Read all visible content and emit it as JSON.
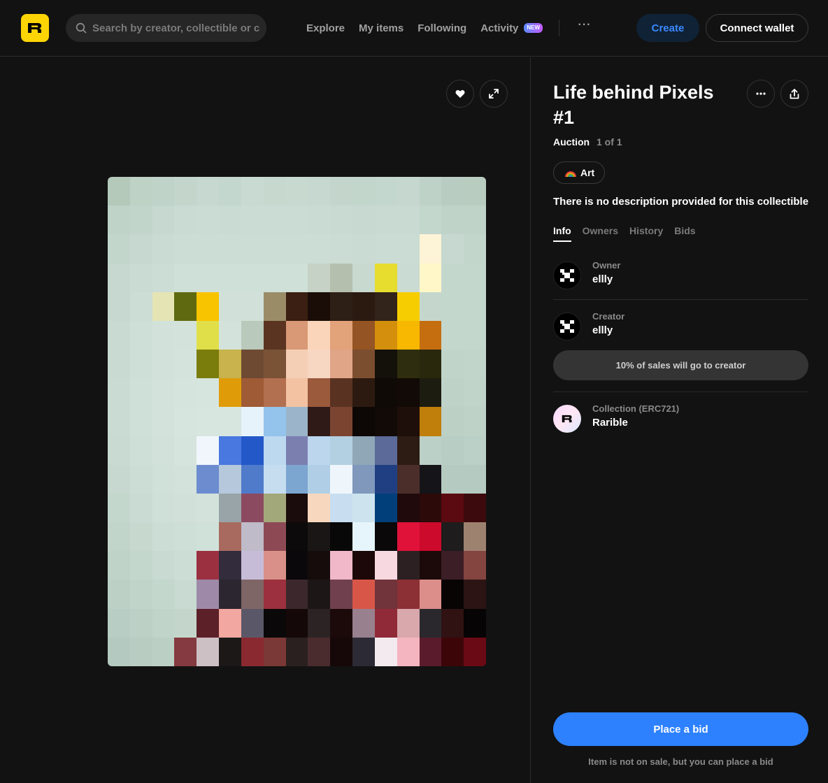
{
  "header": {
    "search_placeholder": "Search by creator, collectible or collection",
    "nav": [
      "Explore",
      "My items",
      "Following",
      "Activity"
    ],
    "activity_badge": "NEW",
    "more_label": "···",
    "create_label": "Create",
    "connect_label": "Connect wallet"
  },
  "item": {
    "title": "Life behind Pixels #1",
    "sale_type": "Auction",
    "edition": "1 of 1",
    "tag": "Art",
    "description": "There is no description provided for this collectible",
    "tabs": [
      "Info",
      "Owners",
      "History",
      "Bids"
    ],
    "active_tab": "Info",
    "owner": {
      "role": "Owner",
      "name": "ellly"
    },
    "creator": {
      "role": "Creator",
      "name": "ellly"
    },
    "royalty_text": "10% of sales will go to creator",
    "collection": {
      "role": "Collection (ERC721)",
      "name": "Rarible"
    }
  },
  "actions": {
    "bid_label": "Place a bid",
    "bid_note": "Item is not on sale, but you can place a bid"
  },
  "colors": {
    "accent": "#2d81ff",
    "logo_yellow": "#fed504",
    "background": "#121212"
  },
  "icons": {
    "search": "search-icon",
    "like": "heart-icon",
    "fullscreen": "expand-icon",
    "options": "more-icon",
    "share": "share-icon"
  },
  "artwork_pixels": [
    [
      "#b4c9b9",
      "#bfd2c6",
      "#bfd3c8",
      "#c4d6cc",
      "#c6d8cf",
      "#c4d7ce",
      "#c8dad1",
      "#c7d9cf",
      "#c8d9d0",
      "#c6d8cf",
      "#c4d6cc",
      "#c3d6cc",
      "#c4d7ce",
      "#c5d7ce",
      "#bed2c7",
      "#b8ccc1",
      "#b8ccbf"
    ],
    [
      "#bfd3c8",
      "#c2d5cb",
      "#c6d8cf",
      "#c9dbd2",
      "#cadcd3",
      "#c9dbd2",
      "#cadcd3",
      "#cadcd3",
      "#cadcd3",
      "#c9dbd2",
      "#c8dad1",
      "#c7d9d0",
      "#c8dad1",
      "#c8dad1",
      "#c4d7cd",
      "#c0d3c9",
      "#bfd3c8"
    ],
    [
      "#c3d6cc",
      "#c6d8cf",
      "#c9dbd2",
      "#cbddd4",
      "#ccddd5",
      "#cbddd4",
      "#ccddd5",
      "#ccddd5",
      "#ccddd5",
      "#cbddd4",
      "#cadcd3",
      "#c9dbd2",
      "#cadcd3",
      "#cadcd3",
      "#fdf3d6",
      "#c6d8cf",
      "#c3d6cc"
    ],
    [
      "#c6d8cf",
      "#c9dbd2",
      "#ccddd5",
      "#cfe0d8",
      "#cfe0d8",
      "#cee0d7",
      "#cfe0d8",
      "#cfe0d8",
      "#cfe0d8",
      "#c5d2c5",
      "#b5bfae",
      "#c8d9d0",
      "#e6dd2e",
      "#c9dbd2",
      "#fff7c8",
      "#c4d7cd",
      "#c4d7cd"
    ],
    [
      "#c6d8cf",
      "#ccddd5",
      "#e4e4b4",
      "#5f6a10",
      "#f8c400",
      "#d1e1d9",
      "#d1e1d9",
      "#9b8c68",
      "#3a1f12",
      "#1a0d08",
      "#2e1f16",
      "#2b1a10",
      "#32241a",
      "#f6cd00",
      "#c5d7cd",
      "#c4d7cd",
      "#c4d7cd"
    ],
    [
      "#c8dad1",
      "#cddfd6",
      "#d2e2da",
      "#d3e3db",
      "#e0df4a",
      "#d3e3db",
      "#b9c9bb",
      "#5a3420",
      "#d99876",
      "#fbd5b9",
      "#e2a27a",
      "#955423",
      "#d4900c",
      "#f8b700",
      "#c56e10",
      "#c4d7cd",
      "#c4d7cd"
    ],
    [
      "#c8dad1",
      "#cddfd6",
      "#d2e2da",
      "#d4e4dc",
      "#7a7d0c",
      "#c8b34c",
      "#6f4a33",
      "#7a5236",
      "#f4cfb5",
      "#f7d7c2",
      "#e0a587",
      "#7b4e2f",
      "#13110a",
      "#2e2d0f",
      "#2a280c",
      "#c0d4ca",
      "#c2d5cb"
    ],
    [
      "#c9dbd2",
      "#cee0d7",
      "#d3e3db",
      "#d5e5dd",
      "#d6e5de",
      "#e09c08",
      "#9e5b35",
      "#b27050",
      "#f3c2a3",
      "#9b5a3c",
      "#5a3222",
      "#2c1a10",
      "#100a06",
      "#120a06",
      "#1c1c10",
      "#bed2c8",
      "#c0d4ca"
    ],
    [
      "#c9dbd2",
      "#cee0d7",
      "#d3e3db",
      "#d6e5de",
      "#d7e6df",
      "#d7e6df",
      "#e7f3fa",
      "#94c3ec",
      "#9bb4ca",
      "#2f1a18",
      "#7b4431",
      "#0d0705",
      "#120a06",
      "#1e0f0a",
      "#c07e0a",
      "#bcd0c6",
      "#bed2c8"
    ],
    [
      "#c8dad1",
      "#cddfd6",
      "#d2e2da",
      "#d5e5dd",
      "#f0f6fc",
      "#4878e0",
      "#2358c8",
      "#bcd9f0",
      "#7b7fb0",
      "#bcd6ee",
      "#b3cfe2",
      "#8fa7b7",
      "#5b6a98",
      "#2d1c14",
      "#bbd0c6",
      "#b8cdc3",
      "#bbd0c6"
    ],
    [
      "#c6d8cf",
      "#cbddd4",
      "#d0e1d9",
      "#d3e3db",
      "#6c8ccf",
      "#b5c8dc",
      "#4f7bca",
      "#c6dcef",
      "#7ca5d0",
      "#b0cfe6",
      "#eef6fc",
      "#7f98bc",
      "#203f82",
      "#4b2e2a",
      "#151418",
      "#b5cac0",
      "#b5cac0"
    ],
    [
      "#c4d7cd",
      "#c9dbd2",
      "#cee0d7",
      "#d1e1d9",
      "#d3e3db",
      "#98a4a7",
      "#8c4a60",
      "#a3a87a",
      "#1a0c0c",
      "#f7d7bd",
      "#c8def0",
      "#cde4ef",
      "#003f7a",
      "#200a0c",
      "#2c0a0a",
      "#5a0a10",
      "#3c0a0c"
    ],
    [
      "#c2d5cb",
      "#c7d9cf",
      "#cbddd4",
      "#cedfd7",
      "#d0e1d9",
      "#a86a5e",
      "#bfbbc8",
      "#8e4a54",
      "#0c0a0a",
      "#1a1616",
      "#080808",
      "#e6f4fc",
      "#0a0808",
      "#e0123a",
      "#cc0a2c",
      "#1e1c1c",
      "#9e8270"
    ],
    [
      "#bfd3c8",
      "#c4d7cd",
      "#c8dad1",
      "#cbddd4",
      "#9a3040",
      "#332c3c",
      "#c6bcd8",
      "#d89088",
      "#0a080a",
      "#160c0c",
      "#f0b8c8",
      "#1c0808",
      "#f8d8e0",
      "#2c2022",
      "#1c0a0a",
      "#3c1e26",
      "#844440"
    ],
    [
      "#bcd0c6",
      "#c0d4ca",
      "#c4d7cd",
      "#c8dad1",
      "#9e8aa8",
      "#2c2630",
      "#7e6666",
      "#9c303e",
      "#3c282c",
      "#1c1616",
      "#70404e",
      "#d85648",
      "#70343a",
      "#8c3036",
      "#dc8e8a",
      "#080404",
      "#2c1414"
    ],
    [
      "#b8cdc3",
      "#bcd0c6",
      "#c0d4ca",
      "#c4d6cc",
      "#5c2028",
      "#f2a8a0",
      "#5a5868",
      "#0a0808",
      "#140808",
      "#2c2424",
      "#1c0a0a",
      "#98808e",
      "#902a38",
      "#d8a8ac",
      "#2a282c",
      "#301212",
      "#060404"
    ],
    [
      "#b4c9bf",
      "#b8ccc1",
      "#bccfc5",
      "#843a40",
      "#ccc0c4",
      "#1c1818",
      "#8a2a30",
      "#7a3836",
      "#2a2020",
      "#4a2c2e",
      "#160808",
      "#2c2a34",
      "#f2eaee",
      "#f4b4c0",
      "#5a1c2c",
      "#3c0608",
      "#6a0a14"
    ],
    [
      "#b0c5bc",
      "#b4c9bf",
      "#b8ccc1",
      "#781c2c",
      "#988090",
      "#281c20",
      "#c07c7c",
      "#a88888",
      "#1c1a1a",
      "#180404",
      "#5a0414",
      "#e8a4a0",
      "#e2d4dc",
      "#f4f0f4",
      "#1e1e34",
      "#a098a4",
      "#3a1c1c"
    ]
  ]
}
